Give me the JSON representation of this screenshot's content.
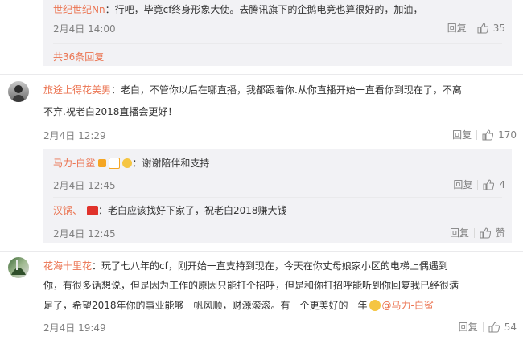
{
  "top_reply": {
    "user": "世纪世纪Nn",
    "text": "：行吧，毕竟cf终身形象大使。去腾讯旗下的企鹅电竞也算很好的，加油，",
    "time": "2月4日 14:00",
    "reply_label": "回复",
    "likes": "35",
    "total_link": "共36条回复"
  },
  "comment1": {
    "user": "旅途上得花美男",
    "text_line1": "：老白，不管你以后在哪直播，我都跟着你.从你直播开始一直看你到现在了，不离",
    "text_line2": "不弃.祝老白2018直播会更好！",
    "time": "2月4日 12:29",
    "reply_label": "回复",
    "likes": "170",
    "replies": [
      {
        "user": "马力-白鲨",
        "text": "：谢谢陪伴和支持",
        "time": "2月4日 12:45",
        "reply_label": "回复",
        "likes": "4"
      },
      {
        "user": "汉锅、",
        "text": "：老白应该找好下家了，祝老白2018赚大钱",
        "time": "2月4日 12:45",
        "reply_label": "回复",
        "likes": "赞"
      }
    ]
  },
  "comment2": {
    "user": "花海十里花",
    "text_line1": "：玩了七八年的cf，刚开始一直支持到现在，今天在你丈母娘家小区的电梯上偶遇到",
    "text_line2": "你，有很多话想说，但是因为工作的原因只能打个招呼，但是和你打招呼能听到你回复我已经很满",
    "text_line3": "足了，希望2018年你的事业能够一帆风顺，财源滚滚。有一个更美好的一年",
    "mention": "@马力-白鲨",
    "time": "2月4日 19:49",
    "reply_label": "回复",
    "likes": "54"
  },
  "colors": {
    "link": "#eb7350",
    "meta": "#808080",
    "panel": "#f2f2f5"
  }
}
